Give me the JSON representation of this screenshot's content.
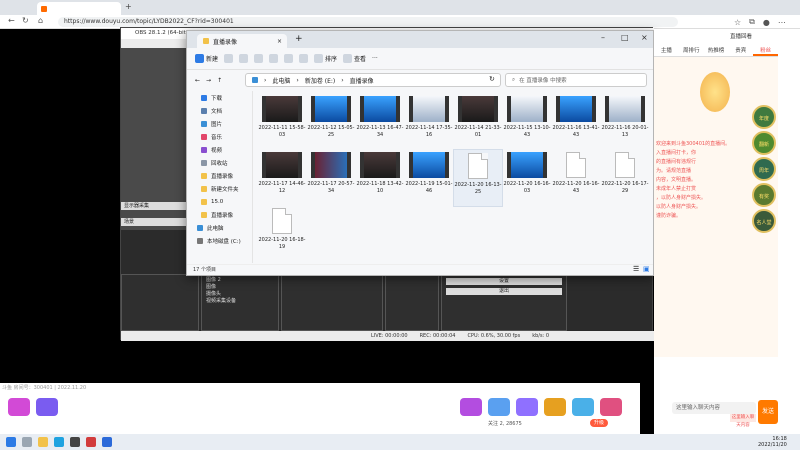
{
  "browser": {
    "tab_title": "",
    "url": "https://www.douyu.com/topic/LYDB2022_CF?rid=300401",
    "new_tab": "+"
  },
  "obs": {
    "title": "OBS 28.1.2 (64-bit, wi",
    "preview_label": "显示器采集",
    "scene_label": "场景",
    "sources": [
      "图像 2",
      "图像",
      "摄像头",
      "视频采集设备"
    ],
    "buttons": [
      "设置",
      "退出"
    ],
    "status": {
      "live": "LIVE: 00:00:00",
      "rec": "REC: 00:00:04",
      "cpu": "CPU: 0.6%, 30.00 fps",
      "kbps": "kb/s: 0"
    }
  },
  "explorer": {
    "tab_title": "直播录像",
    "toolbar": {
      "new": "新建",
      "sort": "排序",
      "view": "查看",
      "more": "···"
    },
    "breadcrumb": [
      "此电脑",
      "新加卷 (E:)",
      "直播录像"
    ],
    "search_placeholder": "在 直播录像 中搜索",
    "nav": [
      {
        "label": "下载",
        "color": "#2d7be5"
      },
      {
        "label": "文档",
        "color": "#5a7fae"
      },
      {
        "label": "图片",
        "color": "#3a8fd6"
      },
      {
        "label": "音乐",
        "color": "#e2466a"
      },
      {
        "label": "视频",
        "color": "#8a4fd0"
      },
      {
        "label": "回收站",
        "color": "#8a96a6"
      },
      {
        "label": "直播录像",
        "color": "#f2c24a"
      },
      {
        "label": "新建文件夹",
        "color": "#f2c24a"
      },
      {
        "label": "15.0",
        "color": "#f2c24a"
      },
      {
        "label": "直播录像",
        "color": "#f2c24a"
      },
      {
        "label": "此电脑",
        "color": "#3a8fd6"
      },
      {
        "label": "本地磁盘 (C:)",
        "color": "#777"
      }
    ],
    "files": [
      {
        "name": "2022-11-11 15-58-03",
        "kind": "dark"
      },
      {
        "name": "2022-11-12 15-05-25",
        "kind": "blue"
      },
      {
        "name": "2022-11-13 16-47-34",
        "kind": "blue"
      },
      {
        "name": "2022-11-14 17-35-16",
        "kind": "white"
      },
      {
        "name": "2022-11-14 21-33-01",
        "kind": "dark"
      },
      {
        "name": "2022-11-15 13-10-43",
        "kind": "white"
      },
      {
        "name": "2022-11-16 13-41-43",
        "kind": "blue"
      },
      {
        "name": "2022-11-16 20-01-13",
        "kind": "white"
      },
      {
        "name": "2022-11-17 14-46-12",
        "kind": "dark"
      },
      {
        "name": "2022-11-17 20-57-34",
        "kind": "mix"
      },
      {
        "name": "2022-11-18 13-42-10",
        "kind": "dark"
      },
      {
        "name": "2022-11-19 15-01-46",
        "kind": "blue"
      },
      {
        "name": "2022-11-20 16-13-25",
        "kind": "doc"
      },
      {
        "name": "2022-11-20 16-16-03",
        "kind": "blue"
      },
      {
        "name": "2022-11-20 16-16-43",
        "kind": "doc"
      },
      {
        "name": "2022-11-20 16-17-29",
        "kind": "doc"
      },
      {
        "name": "2022-11-20 16-18-19",
        "kind": "doc"
      }
    ],
    "status": "17 个项目"
  },
  "right_panel": {
    "tabs": [
      "主播",
      "周排行",
      "热推榜",
      "贵宾",
      "粉丝"
    ],
    "top_link": "直播回看",
    "chat_lines": [
      "欢迎来到斗鱼300401的直播间。",
      "入直播间打卡，你",
      "的直播间有违规行",
      "为。请规范直播",
      "内容，文明直播。",
      "未成年人禁止打赏",
      "，以防人身财产损失。",
      "以防人身财产损失。",
      "谨防诈骗。"
    ],
    "badge_texts": [
      "年度",
      "翻新",
      "周年",
      "有奖",
      "名人堂"
    ],
    "input_placeholder": "这里输入聊天内容",
    "send_label": "发送",
    "extra": "这里输入聊天内容"
  },
  "bottom": {
    "room_info": "斗鱼 房间号：300401 | 2022.11.20",
    "stat": "关注 2, 28675",
    "level_badge": "升级"
  },
  "taskbar": {
    "time": "16:18",
    "date": "2022/11/20"
  }
}
